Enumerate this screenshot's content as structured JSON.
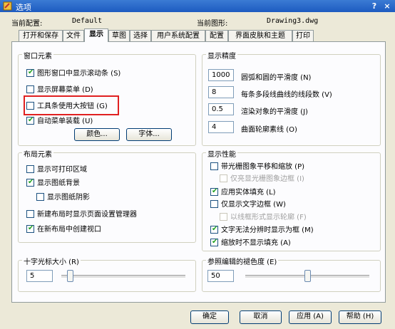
{
  "window": {
    "title": "选项",
    "help_glyph": "?",
    "close_glyph": "×"
  },
  "info": {
    "profile_label": "当前配置:",
    "profile_value": "Default",
    "drawing_label": "当前图形:",
    "drawing_value": "Drawing3.dwg"
  },
  "tabs": [
    {
      "label": "打开和保存"
    },
    {
      "label": "文件"
    },
    {
      "label": "显示"
    },
    {
      "label": "草图"
    },
    {
      "label": "选择"
    },
    {
      "label": "用户系统配置"
    },
    {
      "label": "配置"
    },
    {
      "label": "界面皮肤和主题"
    },
    {
      "label": "打印"
    }
  ],
  "window_elements": {
    "title": "窗口元素",
    "items": [
      {
        "label": "图形窗口中显示滚动条 (S)",
        "checked": true
      },
      {
        "label": "显示屏幕菜单 (D)",
        "checked": false
      },
      {
        "label": "工具条使用大按钮 (G)",
        "checked": false
      },
      {
        "label": "自动菜单装载 (U)",
        "checked": true
      }
    ],
    "colors_button": "颜色...",
    "fonts_button": "字体..."
  },
  "display_precision": {
    "title": "显示精度",
    "rows": [
      {
        "value": "1000",
        "label": "圆弧和圆的平滑度 (N)"
      },
      {
        "value": "8",
        "label": "每条多段线曲线的线段数 (V)"
      },
      {
        "value": "0.5",
        "label": "渲染对象的平滑度 (J)"
      },
      {
        "value": "4",
        "label": "曲面轮廓素线 (O)"
      }
    ]
  },
  "layout_elements": {
    "title": "布局元素",
    "items": [
      {
        "label": "显示可打印区域",
        "checked": false
      },
      {
        "label": "显示图纸背景",
        "checked": true
      },
      {
        "label": "显示图纸阴影",
        "checked": false
      },
      {
        "label": "新建布局时显示页面设置管理器",
        "checked": false
      },
      {
        "label": "在新布局中创建视口",
        "checked": true
      }
    ]
  },
  "display_performance": {
    "title": "显示性能",
    "items": [
      {
        "label": "带光栅图象平移和缩放 (P)",
        "checked": false,
        "disabled": false
      },
      {
        "label": "仅亮显光栅图象边框 (I)",
        "checked": false,
        "disabled": true
      },
      {
        "label": "应用实体填充 (L)",
        "checked": true,
        "disabled": false
      },
      {
        "label": "仅显示文字边框 (W)",
        "checked": false,
        "disabled": false
      },
      {
        "label": "以线框形式显示轮廓 (F)",
        "checked": false,
        "disabled": true
      },
      {
        "label": "文字无法分辨时显示为框 (M)",
        "checked": true,
        "disabled": false
      },
      {
        "label": "缩放时不显示填充 (A)",
        "checked": true,
        "disabled": false
      }
    ]
  },
  "crosshair": {
    "title": "十字光标大小 (R)",
    "value": "5",
    "level": 0.05
  },
  "xref_fade": {
    "title": "参照编辑的褪色度 (E)",
    "value": "50",
    "level": 0.5
  },
  "footer": {
    "ok": "确定",
    "cancel": "取消",
    "apply": "应用 (A)",
    "help": "帮助 (H)"
  }
}
